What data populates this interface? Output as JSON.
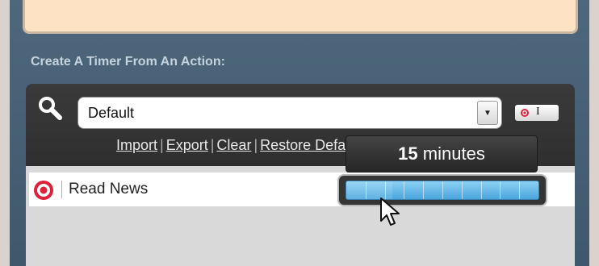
{
  "section": {
    "label": "Create A Timer From An Action:"
  },
  "search": {
    "value": "Default"
  },
  "links": {
    "import": "Import",
    "export": "Export",
    "clear": "Clear",
    "restore": "Restore Default"
  },
  "list": {
    "items": [
      {
        "label": "Read News"
      }
    ]
  },
  "tooltip": {
    "value": "15",
    "unit": "minutes"
  },
  "slider": {
    "fraction": 0.24
  },
  "colors": {
    "accent": "#4aa6dd",
    "target": "#e0203a"
  }
}
